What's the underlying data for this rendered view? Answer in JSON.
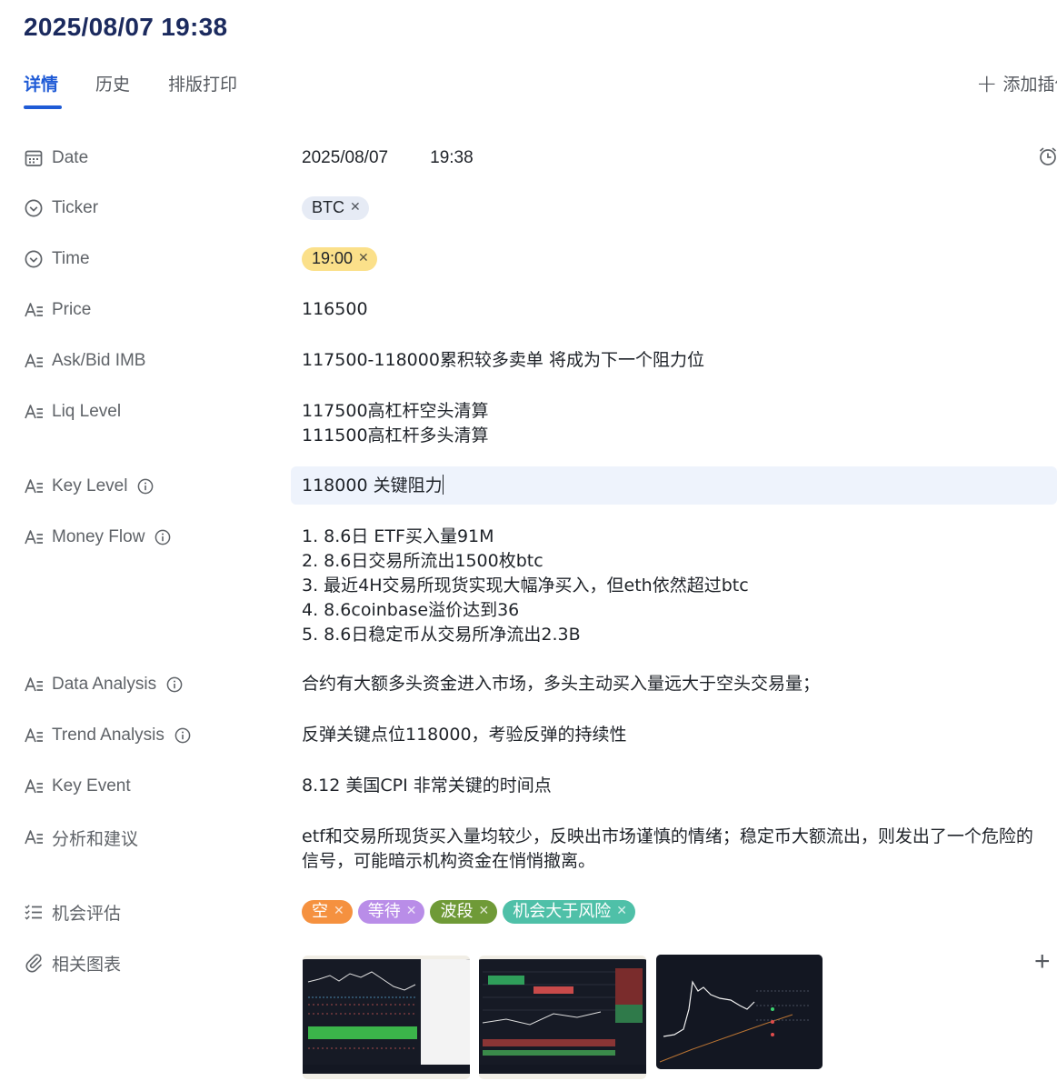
{
  "header": {
    "title": "2025/08/07 19:38"
  },
  "tabs": [
    {
      "label": "详情",
      "active": true
    },
    {
      "label": "历史",
      "active": false
    },
    {
      "label": "排版打印",
      "active": false
    }
  ],
  "add_plugin": {
    "label": "添加插件",
    "icon": "plus-icon"
  },
  "fields": {
    "date": {
      "label": "Date",
      "icon": "calendar-icon",
      "date": "2025/08/07",
      "time": "19:38",
      "action_icon": "alarm-clock-icon"
    },
    "ticker": {
      "label": "Ticker",
      "icon": "single-select-icon",
      "tag": "BTC",
      "tag_color": "#e6ebf5"
    },
    "time": {
      "label": "Time",
      "icon": "single-select-icon",
      "tag": "19:00",
      "tag_color": "#fbe08a"
    },
    "price": {
      "label": "Price",
      "icon": "text-field-icon",
      "value": "116500"
    },
    "ask_bid": {
      "label": "Ask/Bid IMB",
      "icon": "text-field-icon",
      "value": "117500-118000累积较多卖单  将成为下一个阻力位"
    },
    "liq_level": {
      "label": "Liq Level",
      "icon": "text-field-icon",
      "lines": [
        "117500高杠杆空头清算",
        "111500高杠杆多头清算"
      ]
    },
    "key_level": {
      "label": "Key Level",
      "icon": "text-field-icon",
      "value": "118000 关键阻力"
    },
    "money_flow": {
      "label": "Money Flow",
      "icon": "text-field-icon",
      "lines": [
        "1. 8.6日 ETF买入量91M",
        "2. 8.6日交易所流出1500枚btc",
        "3. 最近4H交易所现货实现大幅净买入，但eth依然超过btc",
        "4. 8.6coinbase溢价达到36",
        "5. 8.6日稳定币从交易所净流出2.3B"
      ]
    },
    "data_analysis": {
      "label": "Data Analysis",
      "icon": "text-field-icon",
      "value": "合约有大额多头资金进入市场，多头主动买入量远大于空头交易量；"
    },
    "trend_analysis": {
      "label": "Trend Analysis",
      "icon": "text-field-icon",
      "value": "反弹关键点位118000，考验反弹的持续性"
    },
    "key_event": {
      "label": "Key Event",
      "icon": "text-field-icon",
      "value": "8.12 美国CPI   非常关键的时间点"
    },
    "advice": {
      "label": "分析和建议",
      "icon": "text-field-icon",
      "value": "etf和交易所现货买入量均较少，反映出市场谨慎的情绪；稳定币大额流出，则发出了一个危险的信号，可能暗示机构资金在悄悄撤离。"
    },
    "opportunity": {
      "label": "机会评估",
      "icon": "multi-select-icon",
      "tags": [
        {
          "text": "空",
          "bg": "#f5913f",
          "fg": "#ffffff"
        },
        {
          "text": "等待",
          "bg": "#b98de8",
          "fg": "#ffffff"
        },
        {
          "text": "波段",
          "bg": "#6f9a37",
          "fg": "#ffffff"
        },
        {
          "text": "机会大于风险",
          "bg": "#4fc0a8",
          "fg": "#ffffff"
        }
      ]
    },
    "charts": {
      "label": "相关图表",
      "icon": "paperclip-icon",
      "count": 3
    }
  },
  "colors": {
    "accent": "#1f5bd6",
    "label": "#5f6368",
    "title": "#1b2a5e"
  }
}
